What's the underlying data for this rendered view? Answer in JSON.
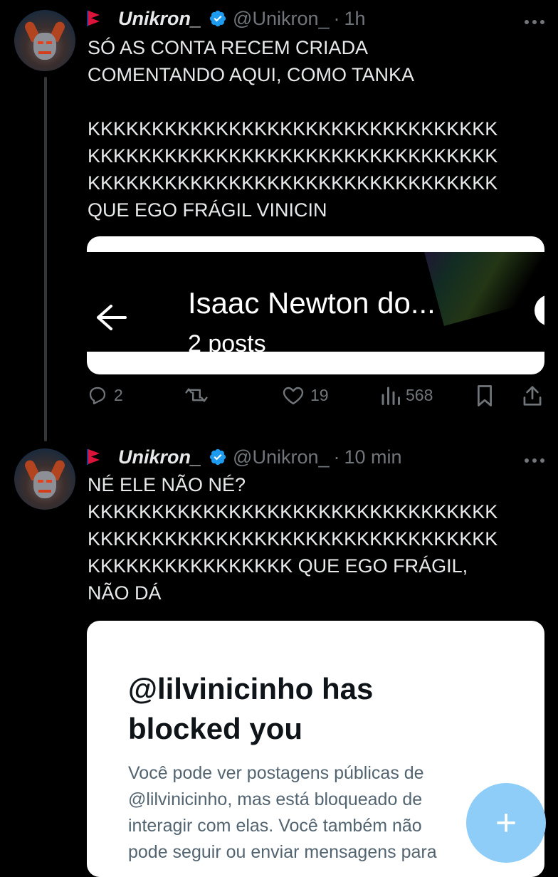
{
  "posts": [
    {
      "name": "Unikron_",
      "handle": "@Unikron_",
      "separator": "·",
      "time": "1h",
      "text": "SÓ AS CONTA RECEM CRIADA\nCOMENTANDO AQUI, COMO TANKA\n\nKKKKKKKKKKKKKKKKKKKKKKKKKKKKKKKK\nKKKKKKKKKKKKKKKKKKKKKKKKKKKKKKKK\nKKKKKKKKKKKKKKKKKKKKKKKKKKKKKKKK\nQUE EGO FRÁGIL VINICIN",
      "embed": {
        "title": "Isaac Newton do...",
        "subtitle": "2 posts"
      },
      "stats": {
        "replies": "2",
        "likes": "19",
        "views": "568"
      }
    },
    {
      "name": "Unikron_",
      "handle": "@Unikron_",
      "separator": "·",
      "time": "10 min",
      "text": "NÉ ELE NÃO NÉ?\nKKKKKKKKKKKKKKKKKKKKKKKKKKKKKKKK\nKKKKKKKKKKKKKKKKKKKKKKKKKKKKKKKK\nKKKKKKKKKKKKKKKK QUE EGO FRÁGIL,\nNÃO DÁ",
      "embed": {
        "title": "@lilvinicinho has\nblocked you",
        "body": "Você pode ver postagens públicas de\n@lilvinicinho, mas está bloqueado de\ninteragir com elas. Você também não\npode seguir ou enviar mensagens para"
      }
    }
  ],
  "icons": {
    "more": "more-icon",
    "verified": "verified-badge-icon",
    "flag": "nepal-flag-icon",
    "compose": "compose-plus-icon"
  },
  "fab_label": "+",
  "colors": {
    "background": "#000000",
    "text": "#e7e9ea",
    "muted": "#71767b",
    "verified": "#1d9bf0",
    "fab": "#8ecdf8"
  }
}
